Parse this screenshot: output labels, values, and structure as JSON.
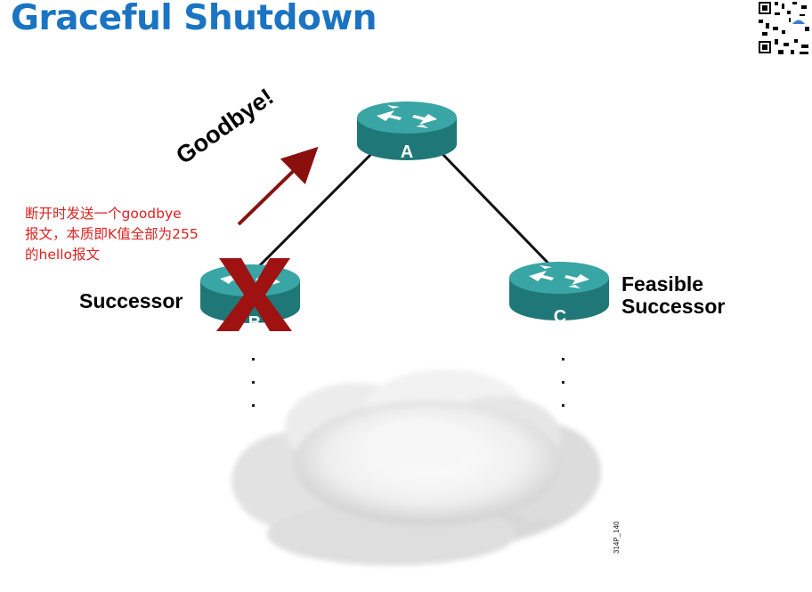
{
  "title": "Graceful Shutdown",
  "routers": {
    "a": "A",
    "b": "B",
    "c": "C"
  },
  "labels": {
    "successor": "Successor",
    "feasible_line1": "Feasible",
    "feasible_line2": "Successor",
    "goodbye": "Goodbye!",
    "figure_code": "314P_140"
  },
  "note": {
    "line1": "断开时发送一个goodbye",
    "line2": "报文，本质即K值全部为255",
    "line3": "的hello报文"
  },
  "colors": {
    "title": "#1a74c2",
    "router": "#2a8f8f",
    "arrow": "#8b0f0f",
    "x_mark": "#a01010",
    "note": "#e02020"
  }
}
